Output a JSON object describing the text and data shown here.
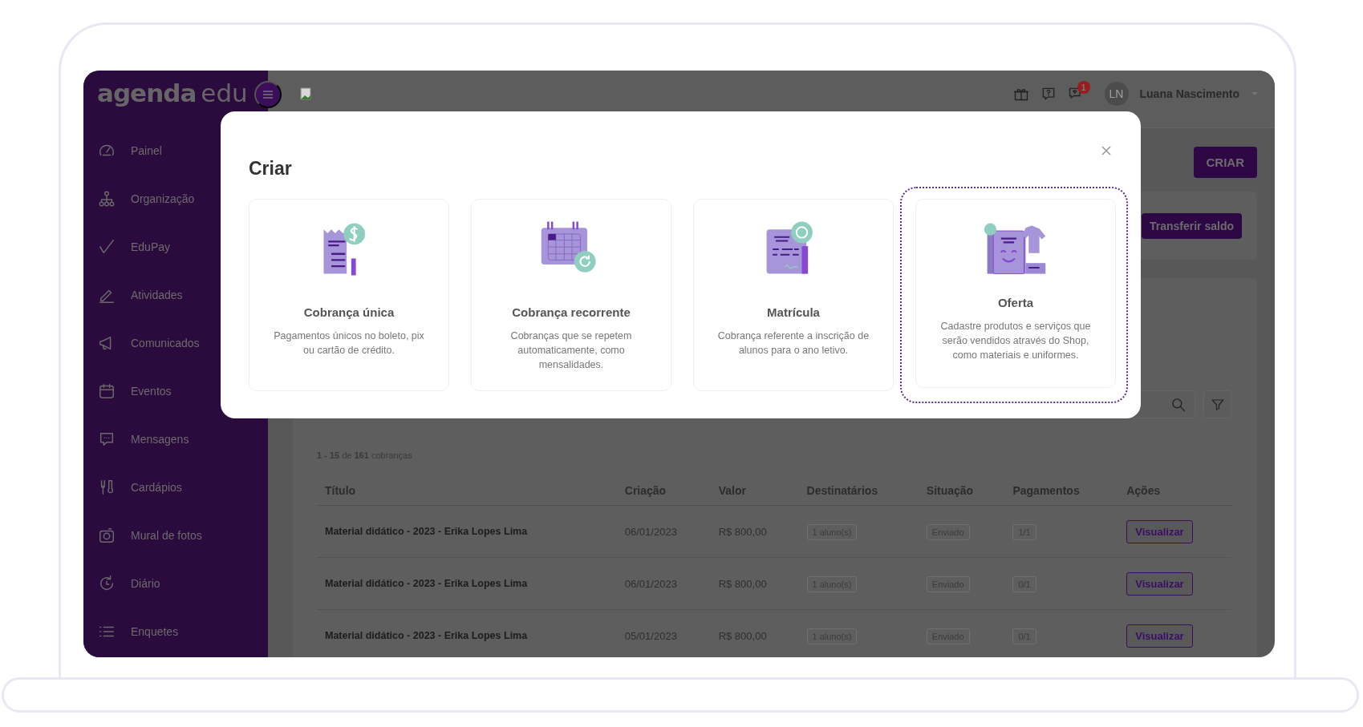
{
  "logo": {
    "main": "agenda",
    "suffix": "edu"
  },
  "sidebar": {
    "items": [
      {
        "label": "Painel"
      },
      {
        "label": "Organização"
      },
      {
        "label": "EduPay"
      },
      {
        "label": "Atividades"
      },
      {
        "label": "Comunicados"
      },
      {
        "label": "Eventos"
      },
      {
        "label": "Mensagens"
      },
      {
        "label": "Cardápios"
      },
      {
        "label": "Mural de fotos"
      },
      {
        "label": "Diário"
      },
      {
        "label": "Enquetes"
      }
    ]
  },
  "topbar": {
    "notification_count": "1",
    "user": {
      "initials": "LN",
      "name": "Luana Nascimento"
    }
  },
  "page": {
    "create_button": "CRIAR",
    "transfer_button": "Transferir saldo",
    "count": "**1 - 15** de **161** cobranças"
  },
  "table": {
    "columns": [
      "Título",
      "Criação",
      "Valor",
      "Destinatários",
      "Situação",
      "Pagamentos",
      "Ações"
    ],
    "rows": [
      {
        "title": "Material didático - 2023 - Erika Lopes Lima",
        "created": "06/01/2023",
        "value": "R$ 800,00",
        "recipients": "1 aluno(s)",
        "status": "Enviado",
        "payments": "1/1",
        "action": "Visualizar"
      },
      {
        "title": "Material didático - 2023 - Erika Lopes Lima",
        "created": "06/01/2023",
        "value": "R$ 800,00",
        "recipients": "1 aluno(s)",
        "status": "Enviado",
        "payments": "0/1",
        "action": "Visualizar"
      },
      {
        "title": "Material didático - 2023 - Erika Lopes Lima",
        "created": "05/01/2023",
        "value": "R$ 800,00",
        "recipients": "1 aluno(s)",
        "status": "Enviado",
        "payments": "0/1",
        "action": "Visualizar"
      }
    ]
  },
  "modal": {
    "title": "Criar",
    "cards": [
      {
        "title": "Cobrança única",
        "description": "Pagamentos únicos no boleto, pix ou cartão de crédito.",
        "selected": false
      },
      {
        "title": "Cobrança recorrente",
        "description": "Cobranças que se repetem automaticamente, como mensalidades.",
        "selected": false
      },
      {
        "title": "Matrícula",
        "description": "Cobrança referente a inscrição de alunos para o ano letivo.",
        "selected": false
      },
      {
        "title": "Oferta",
        "description": "Cadastre produtos e serviços que serão vendidos através do Shop, como materiais e uniformes.",
        "selected": true
      }
    ]
  }
}
